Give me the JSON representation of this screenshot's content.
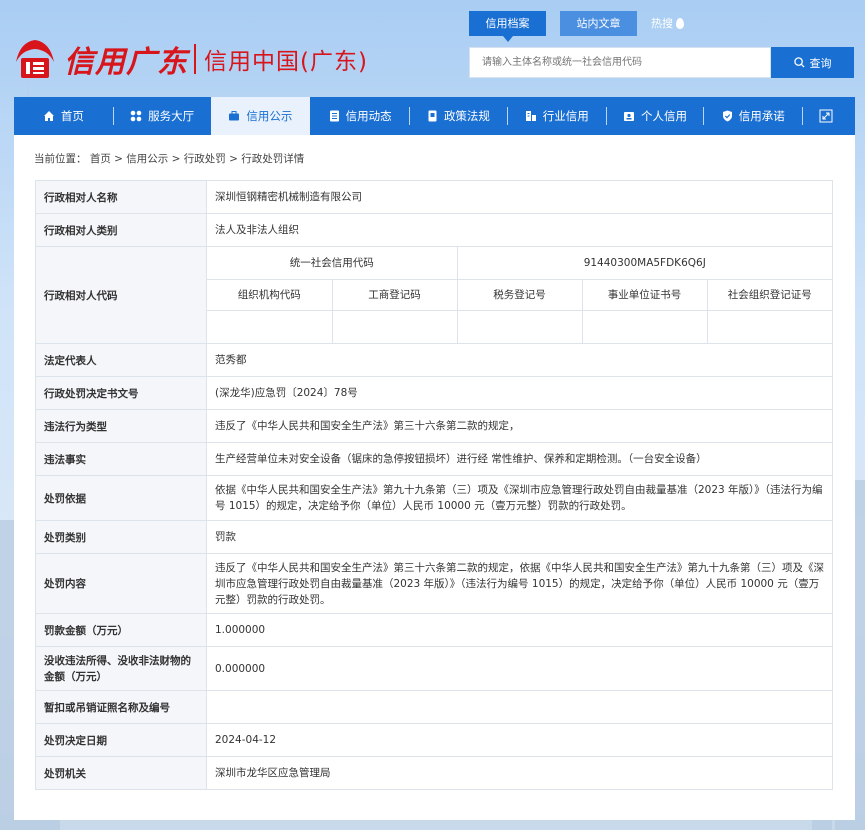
{
  "header": {
    "logo_script": "信用广东",
    "logo_title": "信用中国(广东)",
    "tabs": [
      {
        "label": "信用档案",
        "active": true
      },
      {
        "label": "站内文章",
        "active": false
      },
      {
        "label": "热搜",
        "active": false
      }
    ],
    "search": {
      "placeholder": "请输入主体名称或统一社会信用代码",
      "button_label": "查询"
    }
  },
  "nav": {
    "items": [
      {
        "label": "首页",
        "icon": "home-icon"
      },
      {
        "label": "服务大厅",
        "icon": "grid-icon"
      },
      {
        "label": "信用公示",
        "icon": "briefcase-icon",
        "active": true
      },
      {
        "label": "信用动态",
        "icon": "document-icon"
      },
      {
        "label": "政策法规",
        "icon": "book-icon"
      },
      {
        "label": "行业信用",
        "icon": "building-icon"
      },
      {
        "label": "个人信用",
        "icon": "id-card-icon"
      },
      {
        "label": "信用承诺",
        "icon": "shield-check-icon"
      }
    ],
    "expand_icon": "fullscreen-icon"
  },
  "breadcrumb": "当前位置： 首页 > 信用公示 > 行政处罚 > 行政处罚详情",
  "record": {
    "name": {
      "label": "行政相对人名称",
      "value": "深圳恒钢精密机械制造有限公司"
    },
    "category": {
      "label": "行政相对人类别",
      "value": "法人及非法人组织"
    },
    "codes": {
      "label": "行政相对人代码",
      "uscc_label": "统一社会信用代码",
      "uscc_value": "91440300MA5FDK6Q6J",
      "sub_headers": [
        "组织机构代码",
        "工商登记码",
        "税务登记号",
        "事业单位证书号",
        "社会组织登记证号"
      ],
      "sub_values": [
        "",
        "",
        "",
        "",
        ""
      ]
    },
    "legal_rep": {
      "label": "法定代表人",
      "value": "范秀都"
    },
    "doc_no": {
      "label": "行政处罚决定书文号",
      "value": "(深龙华)应急罚〔2024〕78号"
    },
    "violation_type": {
      "label": "违法行为类型",
      "value": "违反了《中华人民共和国安全生产法》第三十六条第二款的规定，"
    },
    "facts": {
      "label": "违法事实",
      "value": "生产经营单位未对安全设备（锯床的急停按钮损坏）进行经 常性维护、保养和定期检测。（一台安全设备）"
    },
    "basis": {
      "label": "处罚依据",
      "value": "依据《中华人民共和国安全生产法》第九十九条第（三）项及《深圳市应急管理行政处罚自由裁量基准（2023 年版）》（违法行为编号 1015）的规定，决定给予你（单位）人民币 10000 元（壹万元整）罚款的行政处罚。"
    },
    "penalty_type": {
      "label": "处罚类别",
      "value": "罚款"
    },
    "content": {
      "label": "处罚内容",
      "value": "违反了《中华人民共和国安全生产法》第三十六条第二款的规定，依据《中华人民共和国安全生产法》第九十九条第（三）项及《深圳市应急管理行政处罚自由裁量基准（2023 年版）》（违法行为编号 1015）的规定，决定给予你（单位）人民币 10000 元（壹万元整）罚款的行政处罚。"
    },
    "fine": {
      "label": "罚款金额（万元）",
      "value": "1.000000"
    },
    "confiscation": {
      "label": "没收违法所得、没收非法财物的金额（万元）",
      "value": "0.000000"
    },
    "license": {
      "label": "暂扣或吊销证照名称及编号",
      "value": ""
    },
    "date": {
      "label": "处罚决定日期",
      "value": "2024-04-12"
    },
    "authority": {
      "label": "处罚机关",
      "value": "深圳市龙华区应急管理局"
    }
  },
  "colors": {
    "primary": "#1a6fd2",
    "brand_red": "#d8151b",
    "label_bg": "#f4f6f9"
  }
}
